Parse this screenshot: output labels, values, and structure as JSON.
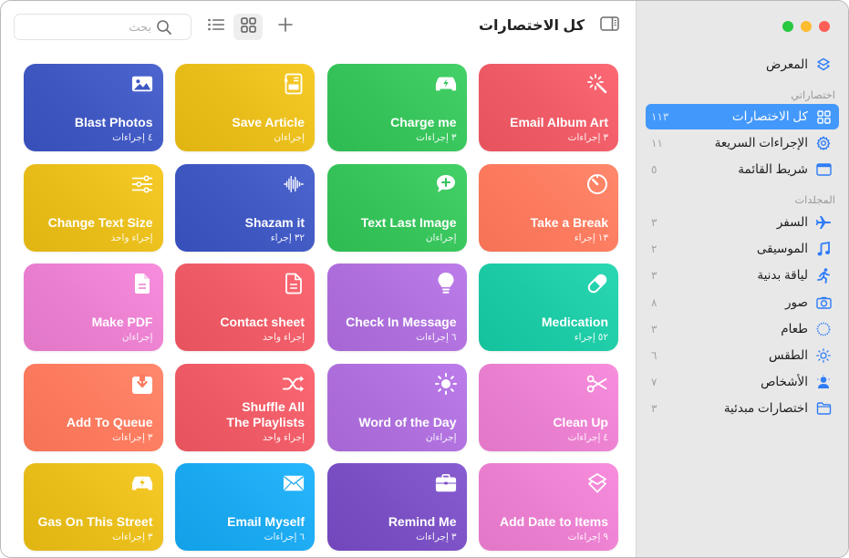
{
  "window": {
    "traffic_lights": {
      "close": "#fe5f57",
      "minimize": "#febc2e",
      "zoom": "#28c840"
    }
  },
  "toolbar": {
    "title": "كل الاختصارات",
    "search_placeholder": "بحث",
    "search_value": "",
    "view_mode": "grid",
    "icons": [
      "sidebar-toggle-icon",
      "list-view-icon",
      "grid-view-icon",
      "plus-icon",
      "search-icon"
    ]
  },
  "sidebar": {
    "gallery": {
      "label": "المعرض",
      "icon": "layers-icon"
    },
    "my_shortcuts_header": "اختصاراتي",
    "my_shortcuts": [
      {
        "label": "كل الاختصارات",
        "count": "١١٣",
        "icon": "grid-icon",
        "selected": true
      },
      {
        "label": "الإجراءات السريعة",
        "count": "١١",
        "icon": "gear-icon",
        "selected": false
      },
      {
        "label": "شريط القائمة",
        "count": "٥",
        "icon": "menubar-icon",
        "selected": false
      }
    ],
    "folders_header": "المجلدات",
    "folders": [
      {
        "label": "السفر",
        "count": "٣",
        "icon": "airplane-icon"
      },
      {
        "label": "الموسيقى",
        "count": "٢",
        "icon": "music-note-icon"
      },
      {
        "label": "لياقة بدنية",
        "count": "٣",
        "icon": "running-figure-icon"
      },
      {
        "label": "صور",
        "count": "٨",
        "icon": "camera-icon"
      },
      {
        "label": "طعام",
        "count": "٣",
        "icon": "dotted-circle-icon"
      },
      {
        "label": "الطقس",
        "count": "٦",
        "icon": "sun-icon"
      },
      {
        "label": "الأشخاص",
        "count": "٧",
        "icon": "person-icon"
      },
      {
        "label": "اختصارات مبدئية",
        "count": "٣",
        "icon": "folder-icon"
      }
    ],
    "accent": "#4398fb"
  },
  "shortcuts": [
    {
      "title": "Email Album Art",
      "actions": "٣ إجراءات",
      "icon": "magic-wand-icon",
      "color": "#ee5b66"
    },
    {
      "title": "Charge me",
      "actions": "٣ إجراءات",
      "icon": "ev-car-icon",
      "color": "#36c35a"
    },
    {
      "title": "Save Article",
      "actions": "إجراءان",
      "icon": "article-icon",
      "color": "#e8bd1a"
    },
    {
      "title": "Blast Photos",
      "actions": "٤ إجراءات",
      "icon": "photo-icon",
      "color": "#3f57c1"
    },
    {
      "title": "Take a Break",
      "actions": "١٣ إجراء",
      "icon": "timer-icon",
      "color": "#fc7a5e"
    },
    {
      "title": "Text Last Image",
      "actions": "إجراءان",
      "icon": "message-plus-icon",
      "color": "#36c35a"
    },
    {
      "title": "Shazam it",
      "actions": "٣٢ إجراء",
      "icon": "waveform-icon",
      "color": "#3f57c1"
    },
    {
      "title": "Change Text Size",
      "actions": "إجراء واحد",
      "icon": "sliders-icon",
      "color": "#e8bd1a"
    },
    {
      "title": "Medication",
      "actions": "٥٢ إجراء",
      "icon": "pill-icon",
      "color": "#1ccaa5"
    },
    {
      "title": "Check In Message",
      "actions": "٦ إجراءات",
      "icon": "lightbulb-icon",
      "color": "#ae6fdc"
    },
    {
      "title": "Contact sheet",
      "actions": "إجراء واحد",
      "icon": "document-icon",
      "color": "#ee5b66"
    },
    {
      "title": "Make PDF",
      "actions": "إجراءان",
      "icon": "document-filled-icon",
      "color": "#ea7fcf"
    },
    {
      "title": "Clean Up",
      "actions": "٤ إجراءات",
      "icon": "scissors-icon",
      "color": "#ea7fcf"
    },
    {
      "title": "Word of the Day",
      "actions": "إجراءان",
      "icon": "sun-icon",
      "color": "#ae6fdc"
    },
    {
      "title": "Shuffle All\nThe Playlists",
      "actions": "إجراء واحد",
      "icon": "shuffle-icon",
      "color": "#ee5b66"
    },
    {
      "title": "Add To Queue",
      "actions": "٣ إجراءات",
      "icon": "download-tray-icon",
      "color": "#fc7a5e"
    },
    {
      "title": "Add Date to Items",
      "actions": "٩ إجراءات",
      "icon": "layers-icon",
      "color": "#ea7fcf"
    },
    {
      "title": "Remind Me",
      "actions": "٣ إجراءات",
      "icon": "briefcase-icon",
      "color": "#7a4fc3"
    },
    {
      "title": "Email Myself",
      "actions": "٦ إجراءات",
      "icon": "envelope-icon",
      "color": "#1aa8ef"
    },
    {
      "title": "Gas On This Street",
      "actions": "٣ إجراءات",
      "icon": "ev-car-icon",
      "color": "#e8bd1a"
    }
  ]
}
